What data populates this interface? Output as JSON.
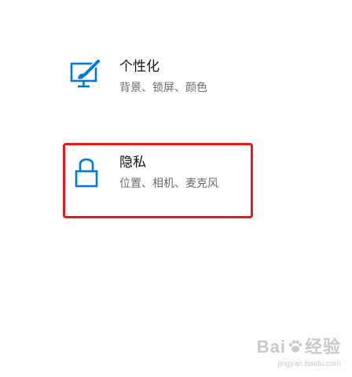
{
  "settings_tiles": [
    {
      "title": "个性化",
      "subtitle": "背景、锁屏、颜色",
      "icon": "personalization-paintbrush-monitor-icon"
    },
    {
      "title": "隐私",
      "subtitle": "位置、相机、麦克风",
      "icon": "lock-icon"
    }
  ],
  "colors": {
    "accent": "#0078d7",
    "highlight": "#e31b1b"
  },
  "watermark": {
    "brand_left": "Bai",
    "brand_right": "经验",
    "site": "jingyan.baidu.com"
  }
}
